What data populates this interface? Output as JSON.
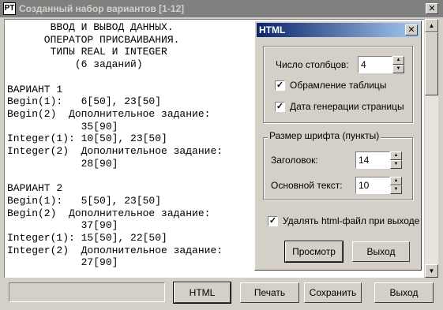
{
  "window": {
    "title": "Созданный набор вариантов [1-12]",
    "icon_label": "PT",
    "close_glyph": "✕"
  },
  "content_lines": [
    "       ВВОД И ВЫВОД ДАННЫХ.",
    "      ОПЕРАТОР ПРИСВАИВАНИЯ.",
    "       ТИПЫ REAL И INTEGER",
    "           (6 заданий)",
    "",
    "ВАРИАНТ 1",
    "Begin(1):   6[50], 23[50]",
    "Begin(2)  Дополнительное задание:",
    "            35[90]",
    "Integer(1): 10[50], 23[50]",
    "Integer(2)  Дополнительное задание:",
    "            28[90]",
    "",
    "ВАРИАНТ 2",
    "Begin(1):   5[50], 23[50]",
    "Begin(2)  Дополнительное задание:",
    "            37[90]",
    "Integer(1): 15[50], 22[50]",
    "Integer(2)  Дополнительное задание:",
    "            27[90]"
  ],
  "buttons": {
    "html": "HTML",
    "print": "Печать",
    "save": "Сохранить",
    "exit": "Выход"
  },
  "dialog": {
    "title": "HTML",
    "columns_label": "Число столбцов:",
    "columns_value": "4",
    "table_border_label": "Обрамление таблицы",
    "table_border_checked": true,
    "gen_date_label": "Дата генерации страницы",
    "gen_date_checked": true,
    "font_group_label": "Размер шрифта (пункты)",
    "heading_label": "Заголовок:",
    "heading_value": "14",
    "body_text_label": "Основной текст:",
    "body_text_value": "10",
    "delete_html_label": "Удалять html-файл при выходе",
    "delete_html_checked": true,
    "preview_button": "Просмотр",
    "exit_button": "Выход",
    "check_glyph": "✓"
  }
}
